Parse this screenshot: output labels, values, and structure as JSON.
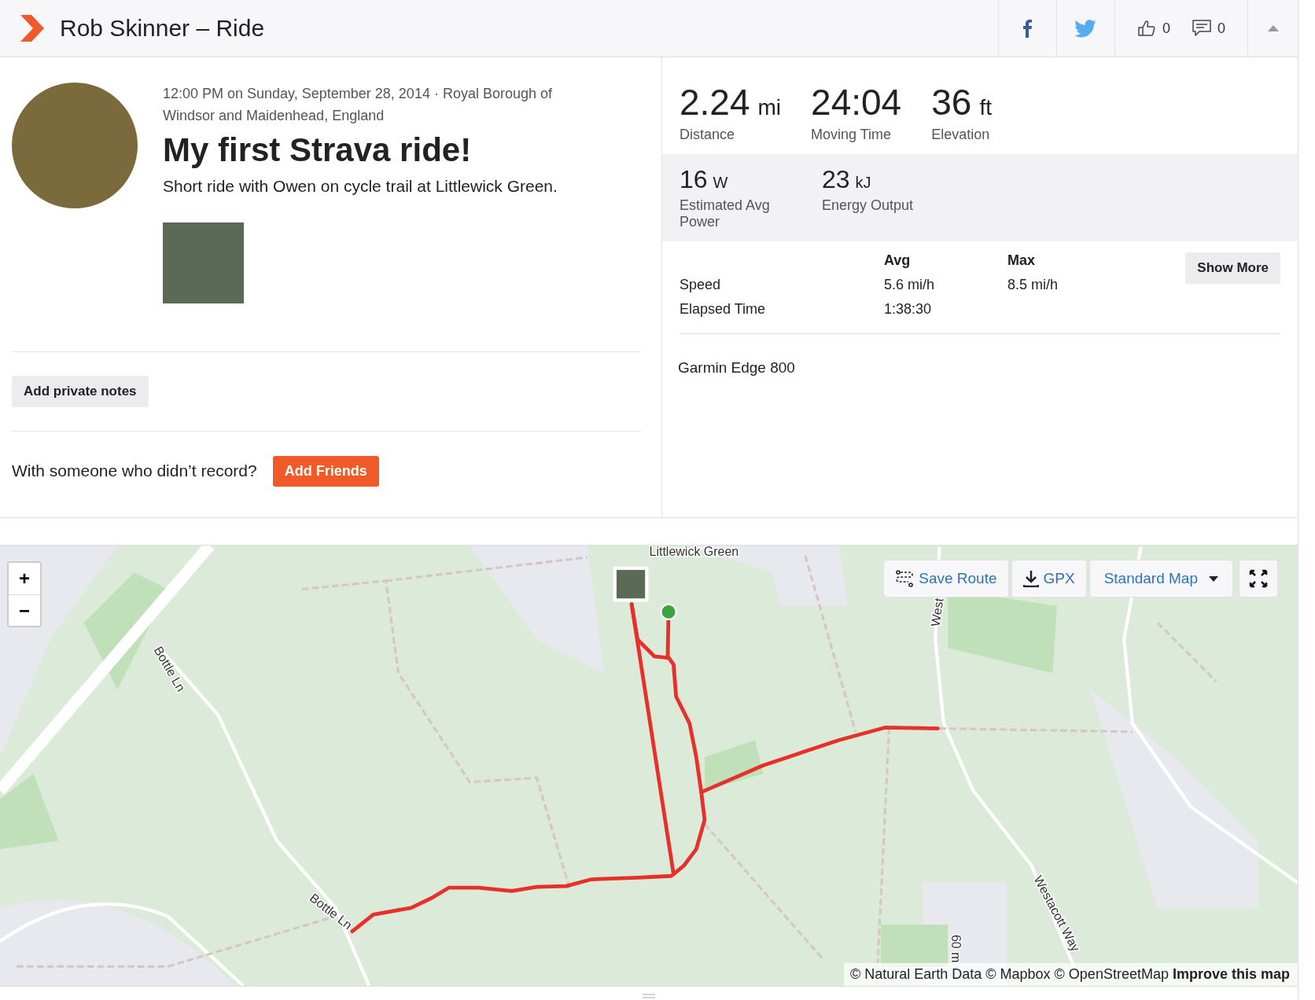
{
  "header": {
    "title": "Rob Skinner – Ride",
    "kudos_count": "0",
    "comment_count": "0"
  },
  "activity": {
    "when_where": "12:00 PM on Sunday, September 28, 2014 · Royal Borough of Windsor and Maidenhead, England",
    "title": "My first Strava ride!",
    "description": "Short ride with Owen on cycle trail at Littlewick Green."
  },
  "notes_button": "Add private notes",
  "friends": {
    "prompt": "With someone who didn’t record?",
    "button": "Add Friends"
  },
  "primary_stats": [
    {
      "value": "2.24",
      "unit": "mi",
      "label": "Distance"
    },
    {
      "value": "24:04",
      "label": "Moving Time"
    },
    {
      "value": "36",
      "unit": "ft",
      "label": "Elevation"
    }
  ],
  "secondary_stats": [
    {
      "value": "16",
      "unit": "W",
      "label": "Estimated Avg Power"
    },
    {
      "value": "23",
      "unit": "kJ",
      "label": "Energy Output"
    }
  ],
  "table": {
    "columns": [
      "Avg",
      "Max"
    ],
    "rows": [
      {
        "label": "Speed",
        "avg": "5.6 mi/h",
        "max": "8.5 mi/h"
      },
      {
        "label": "Elapsed Time",
        "avg": "1:38:30"
      }
    ]
  },
  "show_more": "Show More",
  "device": "Garmin Edge 800",
  "map": {
    "zoom_in": "+",
    "zoom_out": "−",
    "buttons": [
      {
        "kind": "route",
        "label": "Save Route"
      },
      {
        "kind": "download",
        "label": "GPX"
      },
      {
        "kind": "dropdown",
        "label": "Standard Map"
      }
    ],
    "labels": [
      "Littlewick Green",
      "Bottle Ln",
      "Bottle Ln",
      "Westacott Way",
      "West",
      "60 m"
    ],
    "attribution": "© Natural Earth Data © Mapbox © OpenStreetMap",
    "improve_link": "Improve this map"
  }
}
